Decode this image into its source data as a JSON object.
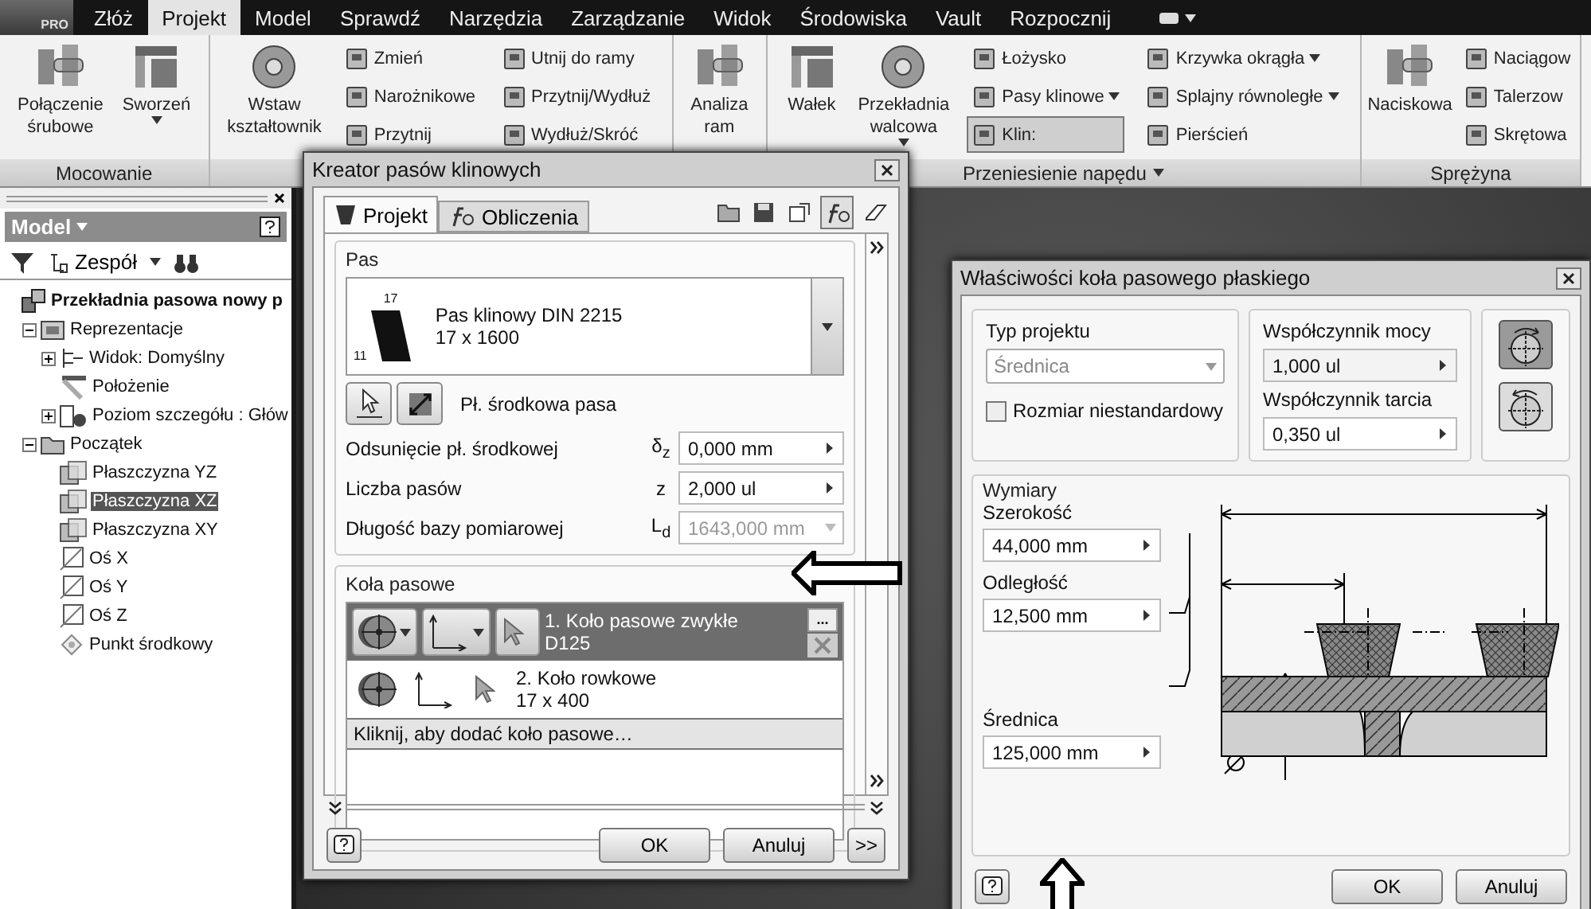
{
  "app_menu": {
    "label": "PRO"
  },
  "ribbon_tabs": [
    {
      "label": "Złóż",
      "selected": false
    },
    {
      "label": "Projekt",
      "selected": true
    },
    {
      "label": "Model",
      "selected": false
    },
    {
      "label": "Sprawdź",
      "selected": false
    },
    {
      "label": "Narzędzia",
      "selected": false
    },
    {
      "label": "Zarządzanie",
      "selected": false
    },
    {
      "label": "Widok",
      "selected": false
    },
    {
      "label": "Środowiska",
      "selected": false
    },
    {
      "label": "Vault",
      "selected": false
    },
    {
      "label": "Rozpocznij",
      "selected": false
    }
  ],
  "ribbon_groups": [
    {
      "label": "Mocowanie",
      "menu": false,
      "items": [
        {
          "kind": "large",
          "lines": [
            "Połączenie",
            "śrubowe"
          ],
          "dropdown": false
        },
        {
          "kind": "large",
          "lines": [
            "Sworzeń"
          ],
          "dropdown": true
        }
      ]
    },
    {
      "items": [
        {
          "kind": "large",
          "lines": [
            "Wstaw",
            "kształtownik"
          ],
          "dropdown": false
        },
        {
          "kind": "column",
          "items": [
            {
              "label": "Zmień",
              "dropdown": false,
              "pressed": false
            },
            {
              "label": "Narożnikowe",
              "dropdown": false,
              "pressed": false
            },
            {
              "label": "Przytnij",
              "dropdown": false,
              "pressed": false
            }
          ]
        },
        {
          "kind": "column",
          "items": [
            {
              "label": "Utnij do ramy",
              "dropdown": false,
              "pressed": false
            },
            {
              "label": "Przytnij/Wydłuż",
              "dropdown": false,
              "pressed": false
            },
            {
              "label": "Wydłuż/Skróć",
              "dropdown": false,
              "pressed": false
            }
          ]
        }
      ]
    },
    {
      "items": [
        {
          "kind": "large",
          "lines": [
            "Analiza",
            "ram"
          ],
          "dropdown": false
        }
      ]
    },
    {
      "label": "Przeniesienie napędu",
      "menu": true,
      "items": [
        {
          "kind": "large",
          "lines": [
            "Wałek"
          ],
          "dropdown": false
        },
        {
          "kind": "large",
          "lines": [
            "Przekładnia",
            "walcowa"
          ],
          "dropdown": true
        },
        {
          "kind": "column",
          "items": [
            {
              "label": "Łożysko",
              "dropdown": false,
              "pressed": false
            },
            {
              "label": "Pasy klinowe",
              "dropdown": true,
              "pressed": false
            },
            {
              "label": "Klin:",
              "dropdown": false,
              "pressed": true
            }
          ]
        },
        {
          "kind": "column",
          "items": [
            {
              "label": "Krzywka okrągła",
              "dropdown": true,
              "pressed": false
            },
            {
              "label": "Splajny równoległe",
              "dropdown": true,
              "pressed": false
            },
            {
              "label": "Pierścień",
              "dropdown": false,
              "pressed": false
            }
          ]
        }
      ]
    },
    {
      "label": "Sprężyna",
      "menu": false,
      "items": [
        {
          "kind": "large",
          "lines": [
            "Naciskowa"
          ],
          "dropdown": false
        },
        {
          "kind": "column",
          "items": [
            {
              "label": "Naciągow",
              "dropdown": false,
              "pressed": false
            },
            {
              "label": "Talerzow",
              "dropdown": false,
              "pressed": false
            },
            {
              "label": "Skrętowa",
              "dropdown": false,
              "pressed": false
            }
          ]
        }
      ]
    }
  ],
  "model_tree": {
    "title": "Model",
    "filter_label": "Zespół",
    "nodes": [
      {
        "label": "Przekładnia pasowa nowy p",
        "kind": "assembly",
        "selected": false,
        "children": [
          {
            "label": "Reprezentacje",
            "kind": "representations",
            "expanded": true,
            "selected": false,
            "children": [
              {
                "label": "Widok: Domyślny",
                "kind": "view",
                "expanded": false,
                "selected": false
              },
              {
                "label": "Położenie",
                "kind": "position",
                "selected": false
              },
              {
                "label": "Poziom szczegółu : Głów",
                "kind": "lod",
                "expanded": false,
                "selected": false
              }
            ]
          },
          {
            "label": "Początek",
            "kind": "folder",
            "expanded": true,
            "selected": false,
            "children": [
              {
                "label": "Płaszczyzna YZ",
                "kind": "plane",
                "selected": false
              },
              {
                "label": "Płaszczyzna XZ",
                "kind": "plane",
                "selected": true
              },
              {
                "label": "Płaszczyzna XY",
                "kind": "plane",
                "selected": false
              },
              {
                "label": "Oś X",
                "kind": "axis",
                "selected": false
              },
              {
                "label": "Oś Y",
                "kind": "axis",
                "selected": false
              },
              {
                "label": "Oś Z",
                "kind": "axis",
                "selected": false
              },
              {
                "label": "Punkt środkowy",
                "kind": "point",
                "selected": false
              }
            ]
          }
        ]
      }
    ]
  },
  "belt_wizard": {
    "title": "Kreator pasów klinowych",
    "tabs": [
      {
        "label": "Projekt",
        "selected": true
      },
      {
        "label": "Obliczenia",
        "selected": false
      }
    ],
    "belt_group": {
      "title": "Pas",
      "belt": {
        "top_dimension": "17",
        "side_dimension": "11",
        "name": "Pas klinowy DIN 2215",
        "size": "17 x 1600"
      },
      "plane_label": "Pł. środkowa pasa",
      "fields": [
        {
          "label": "Odsunięcie pł. środkowej",
          "symbol": "δ$_{z}$",
          "value": "0,000 mm",
          "kind": "spin",
          "disabled": false
        },
        {
          "label": "Liczba pasów",
          "symbol": "z",
          "value": "2,000 ul",
          "kind": "spin",
          "disabled": false
        },
        {
          "label": "Długość bazy pomiarowej",
          "symbol": "L$_{d}$",
          "value": "1643,000 mm",
          "kind": "dropdown",
          "disabled": true
        }
      ]
    },
    "pulleys_group": {
      "title": "Koła pasowe",
      "more_button": "...",
      "pulleys": [
        {
          "name": "1. Koło pasowe zwykłe",
          "size": "D125",
          "selected": true
        },
        {
          "name": "2. Koło rowkowe",
          "size": "17 x 400",
          "selected": false
        }
      ],
      "add_row": "Kliknij, aby dodać koło pasowe…"
    },
    "buttons": {
      "ok": "OK",
      "cancel": "Anuluj",
      "more": ">>"
    }
  },
  "pulley_properties": {
    "title": "Właściwości koła pasowego płaskiego",
    "design_type": {
      "label": "Typ projektu",
      "value": "Średnica",
      "disabled": true
    },
    "custom_size": {
      "label": "Rozmiar niestandardowy",
      "checked": false
    },
    "power_factor": {
      "label": "Współczynnik mocy",
      "value": "1,000 ul"
    },
    "friction_factor": {
      "label": "Współczynnik tarcia",
      "value": "0,350 ul"
    },
    "rotation": [
      {
        "selected": true
      },
      {
        "selected": false
      }
    ],
    "dimensions": {
      "title": "Wymiary",
      "fields": [
        {
          "label": "Szerokość",
          "value": "44,000 mm"
        },
        {
          "label": "Odległość",
          "value": "12,500 mm"
        },
        {
          "label": "Średnica",
          "value": "125,000 mm"
        }
      ]
    },
    "buttons": {
      "ok": "OK",
      "cancel": "Anuluj"
    }
  }
}
